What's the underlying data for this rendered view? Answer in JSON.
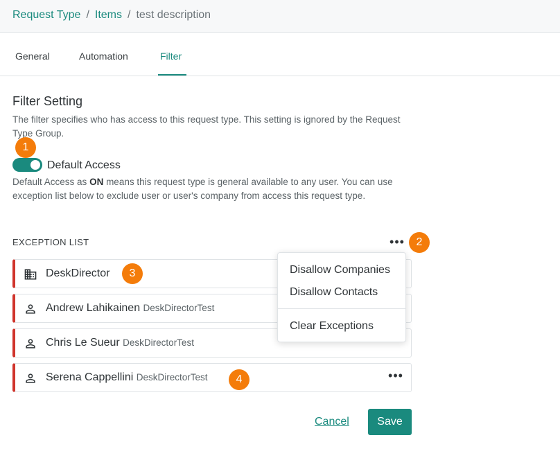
{
  "breadcrumb": {
    "items": [
      "Request Type",
      "Items"
    ],
    "separator": "/",
    "current": "test description"
  },
  "tabs": [
    {
      "label": "General"
    },
    {
      "label": "Automation"
    },
    {
      "label": "Filter",
      "active": true
    }
  ],
  "filter": {
    "title": "Filter Setting",
    "description": "The filter specifies who has access to this request type. This setting is ignored by the Request Type Group.",
    "default_access_label": "Default Access",
    "default_access_on": true,
    "access_desc_prefix": "Default Access as ",
    "access_desc_bold": "ON",
    "access_desc_suffix": " means this request type is general available to any user. You can use exception list below to exclude user or user's company from access this request type."
  },
  "exception_list": {
    "title": "EXCEPTION LIST",
    "more_glyph": "•••",
    "items": [
      {
        "name": "DeskDirector",
        "sub": "",
        "icon": "building-icon"
      },
      {
        "name": "Andrew Lahikainen",
        "sub": "DeskDirectorTest",
        "icon": "person-icon"
      },
      {
        "name": "Chris Le Sueur",
        "sub": "DeskDirectorTest",
        "icon": "person-icon"
      },
      {
        "name": "Serena Cappellini",
        "sub": "DeskDirectorTest",
        "icon": "person-icon"
      }
    ]
  },
  "menu": {
    "items": [
      "Disallow Companies",
      "Disallow Contacts",
      "Clear Exceptions"
    ]
  },
  "badges": [
    "1",
    "2",
    "3",
    "4"
  ],
  "actions": {
    "cancel": "Cancel",
    "save": "Save"
  },
  "colors": {
    "accent": "#1a8a7e",
    "exception_border": "#d0342c",
    "badge": "#f47c0a"
  }
}
